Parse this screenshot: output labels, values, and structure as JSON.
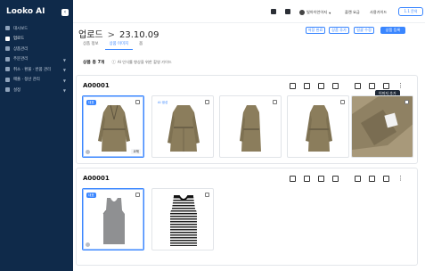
{
  "sidebar": {
    "brand": "Looko AI",
    "collapse_icon": "chevron-left-icon",
    "items": [
      {
        "label": "대시보드",
        "icon": "dashboard-icon",
        "active": false,
        "has_children": false
      },
      {
        "label": "업로드",
        "icon": "upload-icon",
        "active": true,
        "has_children": false
      },
      {
        "label": "상품관리",
        "icon": "user-icon",
        "active": false,
        "has_children": false
      },
      {
        "label": "주문관리",
        "icon": "cart-icon",
        "active": false,
        "has_children": true
      },
      {
        "label": "취소 · 환불 · 반품 관리",
        "icon": "return-icon",
        "active": false,
        "has_children": true
      },
      {
        "label": "매출 · 정산 관리",
        "icon": "won-icon",
        "active": false,
        "has_children": true
      },
      {
        "label": "설정",
        "icon": "gear-icon",
        "active": false,
        "has_children": true
      }
    ]
  },
  "topbar": {
    "user_name": "빛아이언이지",
    "plan_link": "플랜 요금",
    "guide_link": "사용가이드",
    "badge": "1.1 문의"
  },
  "page": {
    "breadcrumb_root": "업로드",
    "breadcrumb_sep": ">",
    "title": "23.10.09",
    "buttons": {
      "save": "저장 완료",
      "add_product": "상품 추가",
      "bulk_edit": "일괄 수정",
      "register": "상품 등록"
    },
    "tabs": [
      {
        "label": "상품 정보",
        "active": false
      },
      {
        "label": "상품 이미지",
        "active": true
      },
      {
        "label": "옵",
        "active": false
      }
    ],
    "count_label": "상품 총 7개",
    "guide_text": "AI 인식률 향상을 위한 촬영 가이드"
  },
  "cards": [
    {
      "code": "A00001",
      "tooltip": "이미지 추가",
      "images": [
        {
          "subject": "trench-coat-front",
          "tag": "대표",
          "selected": true,
          "swap": "교체"
        },
        {
          "subject": "trench-coat-back",
          "tag": "AI 생성",
          "selected": false,
          "swap": ""
        },
        {
          "subject": "trench-coat-side",
          "tag": "",
          "selected": false,
          "swap": ""
        },
        {
          "subject": "trench-coat-detail",
          "tag": "",
          "selected": false,
          "swap": ""
        },
        {
          "subject": "trench-coat-label-closeup",
          "tag": "",
          "selected": false,
          "swap": ""
        }
      ]
    },
    {
      "code": "A00001",
      "tooltip": "",
      "images": [
        {
          "subject": "gray-tank-top",
          "tag": "대표",
          "selected": true,
          "swap": ""
        },
        {
          "subject": "striped-tank-top",
          "tag": "",
          "selected": false,
          "swap": ""
        }
      ]
    }
  ],
  "colors": {
    "sidebar_bg": "#0f2a4a",
    "accent": "#3a86ff",
    "coat": "#8b7d5c",
    "tank_gray": "#8f9092"
  }
}
